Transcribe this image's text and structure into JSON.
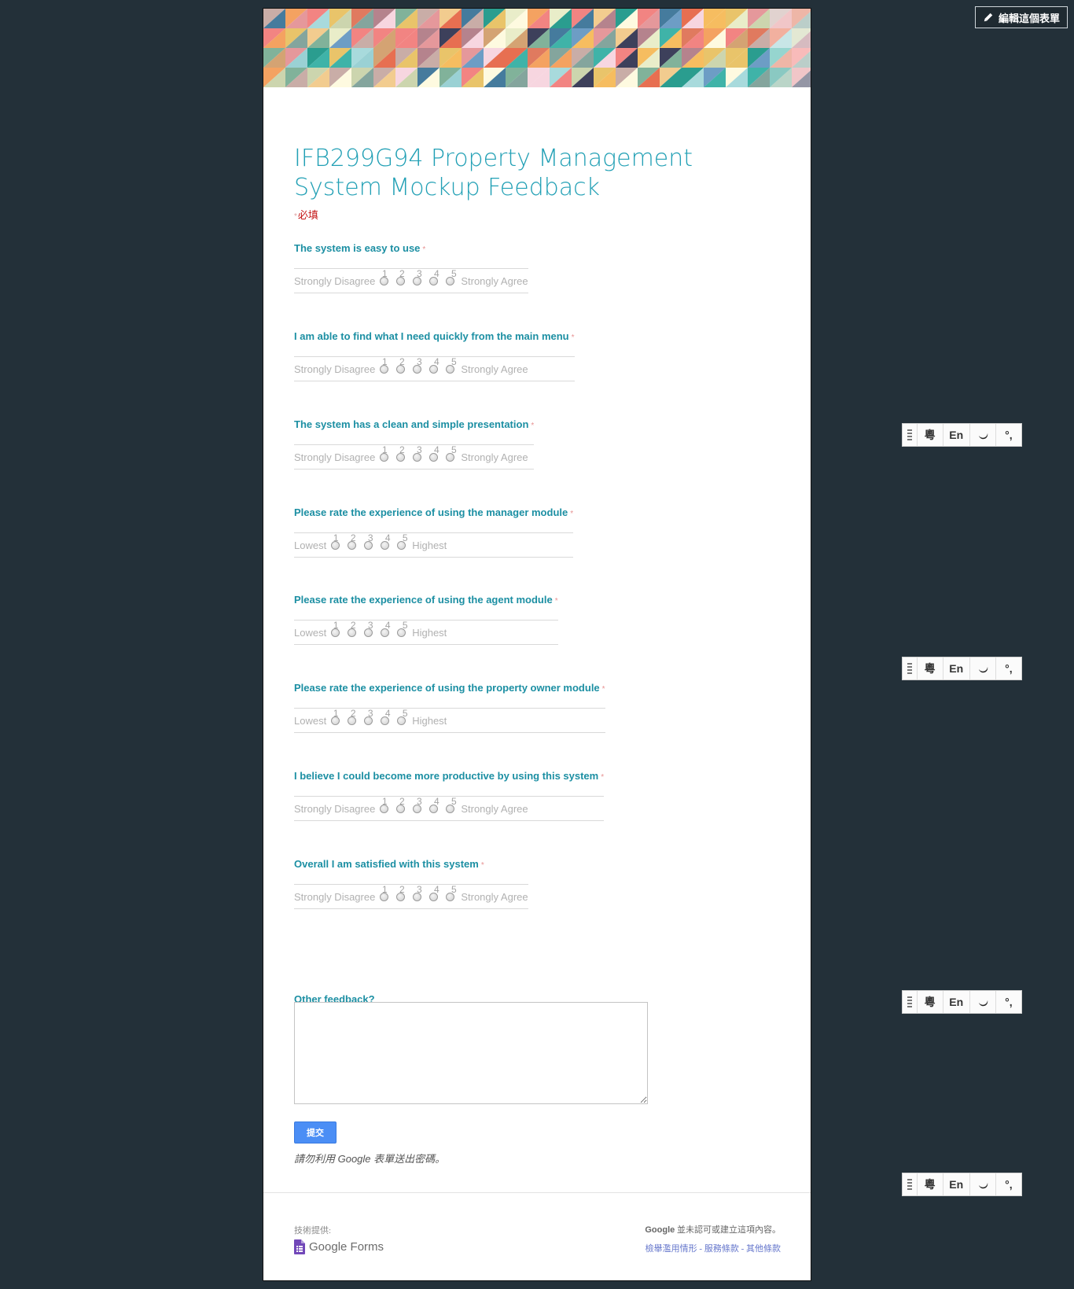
{
  "edit_button": {
    "label": "編輯這個表單",
    "icon": "pencil-icon"
  },
  "form": {
    "title": "IFB299G94 Property Management System Mockup Feedback",
    "required_note": "必填",
    "required_mark": "*"
  },
  "scale_numbers": [
    "1",
    "2",
    "3",
    "4",
    "5"
  ],
  "questions": [
    {
      "title": "The system is easy to use",
      "low": "Strongly Disagree",
      "high": "Strongly Agree"
    },
    {
      "title": "I am able to find what I need quickly from the main menu",
      "low": "Strongly Disagree",
      "high": "Strongly Agree"
    },
    {
      "title": "The system has a clean and simple presentation",
      "low": "Strongly Disagree",
      "high": "Strongly Agree"
    },
    {
      "title": "Please rate the experience of using the manager module",
      "low": "Lowest",
      "high": "Highest"
    },
    {
      "title": "Please rate the experience of using the agent module",
      "low": "Lowest",
      "high": "Highest"
    },
    {
      "title": "Please rate the experience of using the property owner module",
      "low": "Lowest",
      "high": "Highest"
    },
    {
      "title": "I believe I could become more productive by using this system",
      "low": "Strongly Disagree",
      "high": "Strongly Agree"
    },
    {
      "title": "Overall I am satisfied with this system",
      "low": "Strongly Disagree",
      "high": "Strongly Agree"
    }
  ],
  "feedback": {
    "title": "Other feedback?",
    "value": ""
  },
  "submit_label": "提交",
  "password_warning": "請勿利用 Google 表單送出密碼。",
  "footer": {
    "powered_by": "技術提供:",
    "logo_text": "Google Forms",
    "disclaimer_brand": "Google",
    "disclaimer": " 並未認可或建立這項內容。",
    "link_abuse": "檢舉濫用情形",
    "link_terms": "服務條款",
    "link_other": "其他條款",
    "separator": " - "
  },
  "ime_toolbar": {
    "lang": "粵",
    "mode": "En",
    "punct": "°,"
  }
}
